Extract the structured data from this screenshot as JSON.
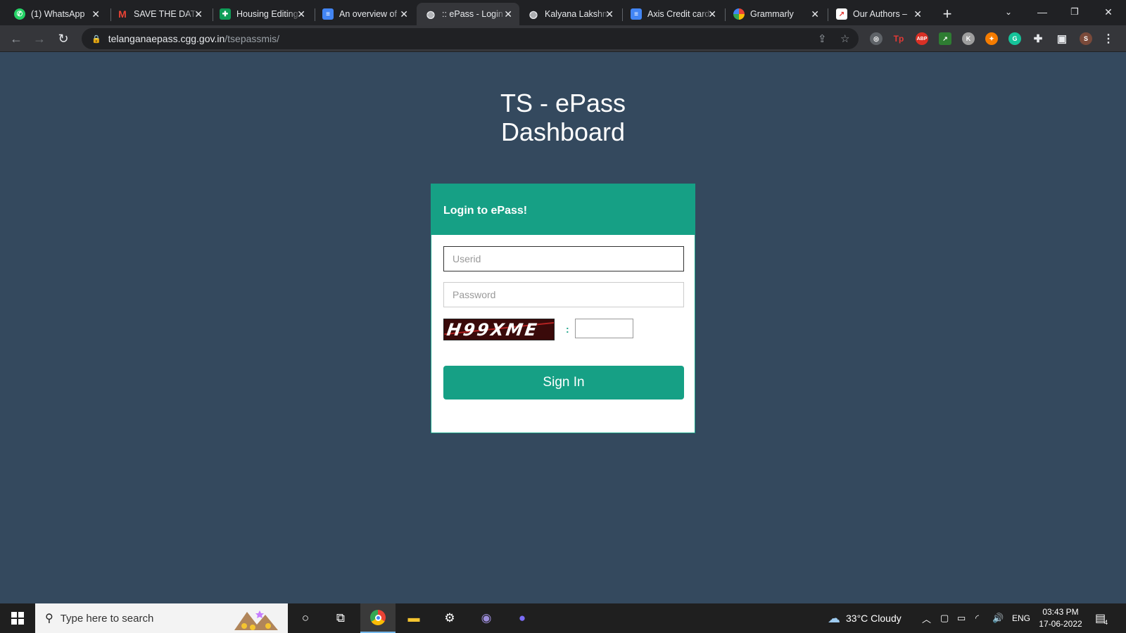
{
  "browser": {
    "tabs": [
      {
        "title": "(1) WhatsApp",
        "favicon": "whatsapp-icon",
        "color": "#25d366",
        "active": false
      },
      {
        "title": "SAVE THE DATE",
        "favicon": "gmail-icon",
        "color": "#ea4335",
        "active": false
      },
      {
        "title": "Housing Editing",
        "favicon": "sheets-icon",
        "color": "#0f9d58",
        "active": false
      },
      {
        "title": "An overview of",
        "favicon": "docs-icon",
        "color": "#4285f4",
        "active": false
      },
      {
        "title": ":: ePass - Login",
        "favicon": "globe-icon",
        "color": "#e8eaed",
        "active": true
      },
      {
        "title": "Kalyana Lakshmi",
        "favicon": "globe-icon",
        "color": "#e8eaed",
        "active": false
      },
      {
        "title": "Axis Credit card",
        "favicon": "docs-icon",
        "color": "#4285f4",
        "active": false
      },
      {
        "title": "Grammarly",
        "favicon": "google-icon",
        "color": "#fbbc05",
        "active": false
      },
      {
        "title": "Our Authors –",
        "favicon": "authors-icon",
        "color": "#e53935",
        "active": false
      }
    ],
    "url_host": "telanganaepass.cgg.gov.in",
    "url_path": "/tsepassmis/",
    "profile_initial": "S"
  },
  "page": {
    "title_line1": "TS - ePass",
    "title_line2": "Dashboard",
    "card_header": "Login to ePass!",
    "userid_placeholder": "Userid",
    "password_placeholder": "Password",
    "captcha_text": "H99XME",
    "captcha_separator": ":",
    "signin_label": "Sign In",
    "colors": {
      "background": "#34495e",
      "accent": "#16a085"
    }
  },
  "taskbar": {
    "search_placeholder": "Type here to search",
    "weather": "33°C  Cloudy",
    "language": "ENG",
    "time": "03:43 PM",
    "date": "17-06-2022",
    "notification_count": "4"
  }
}
